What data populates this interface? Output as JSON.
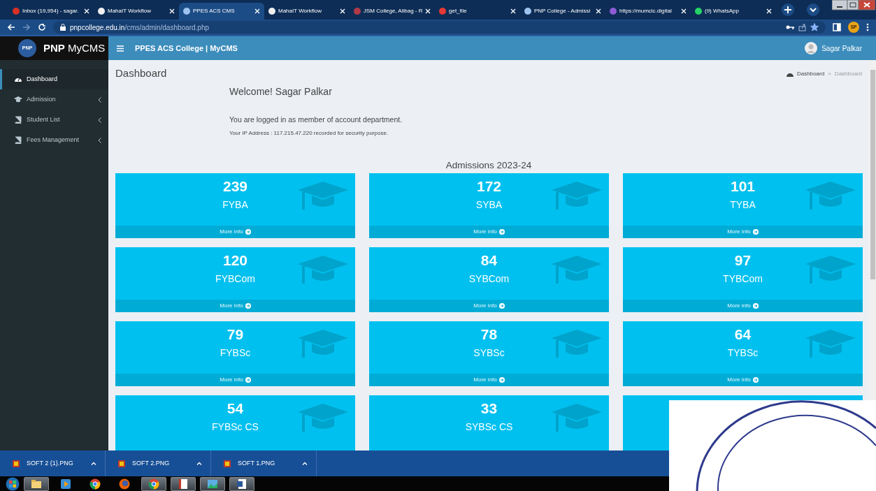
{
  "browser": {
    "tabs": [
      {
        "title": "Inbox (19,954) - sagar.",
        "selected": false,
        "color": "#d93025"
      },
      {
        "title": "MahaIT Workflow",
        "selected": false,
        "color": "#f0f0f0"
      },
      {
        "title": "PPES ACS CMS",
        "selected": true,
        "color": "#9ec3ef"
      },
      {
        "title": "MahaIT Workflow",
        "selected": false,
        "color": "#f0f0f0"
      },
      {
        "title": "JSM College, Alibag - R",
        "selected": false,
        "color": "#b23a48"
      },
      {
        "title": "get_file",
        "selected": false,
        "color": "#e53935"
      },
      {
        "title": "PNP College - Admissi",
        "selected": false,
        "color": "#9ec3ef"
      },
      {
        "title": "https://mumclc.digital",
        "selected": false,
        "color": "#8e5bd6"
      },
      {
        "title": "(9) WhatsApp",
        "selected": false,
        "color": "#25d366"
      }
    ],
    "url_host": "pnpcollege.edu.in",
    "url_path": "/cms/admin/dashboard.php",
    "forward_disabled": true,
    "bookmarked": true,
    "profile_initials": "SP"
  },
  "sidebar": {
    "logo_text": "PNP",
    "brand": "**PNP** MyCMS",
    "items": [
      {
        "label": "Dashboard",
        "kind": "gauge",
        "selected": true,
        "expandable": false
      },
      {
        "label": "Admission",
        "kind": "cap",
        "selected": false,
        "expandable": true
      },
      {
        "label": "Student List",
        "kind": "book",
        "selected": false,
        "expandable": true
      },
      {
        "label": "Fees Management",
        "kind": "book",
        "selected": false,
        "expandable": true
      }
    ]
  },
  "header": {
    "title": "PPES ACS College | MyCMS",
    "user": "Sagar Palkar"
  },
  "page": {
    "title": "Dashboard",
    "breadcrumb": [
      "Dashboard",
      ">",
      "Dashboard"
    ],
    "welcome": "Welcome! Sagar Palkar",
    "role_text": "You are logged in as member of account department.",
    "ip_text": "Your IP Address : 117.215.47.220 recorded for security purpose.",
    "section_title": "Admissions 2023-24",
    "boxes": [
      {
        "count": "239",
        "label": "FYBA",
        "footer": "More info"
      },
      {
        "count": "172",
        "label": "SYBA",
        "footer": "More info"
      },
      {
        "count": "101",
        "label": "TYBA",
        "footer": "More info"
      },
      {
        "count": "120",
        "label": "FYBCom",
        "footer": "More info"
      },
      {
        "count": "84",
        "label": "SYBCom",
        "footer": "More info"
      },
      {
        "count": "97",
        "label": "TYBCom",
        "footer": "More info"
      },
      {
        "count": "79",
        "label": "FYBSc",
        "footer": "More info"
      },
      {
        "count": "78",
        "label": "SYBSc",
        "footer": "More info"
      },
      {
        "count": "64",
        "label": "TYBSc",
        "footer": "More info"
      },
      {
        "count": "54",
        "label": "FYBSc CS"
      },
      {
        "count": "33",
        "label": "SYBSc CS"
      }
    ]
  },
  "downloads": [
    {
      "name": "SOFT 2 (1).PNG"
    },
    {
      "name": "SOFT 2.PNG"
    },
    {
      "name": "SOFT 1.PNG"
    }
  ],
  "taskbar": {
    "apps": [
      {
        "kind": "folder",
        "open": true
      },
      {
        "kind": "player",
        "open": false
      },
      {
        "kind": "chrome",
        "open": false
      },
      {
        "kind": "firefox",
        "open": false
      },
      {
        "kind": "chrome",
        "open": true
      },
      {
        "kind": "book",
        "open": true
      },
      {
        "kind": "photo",
        "open": true
      },
      {
        "kind": "word",
        "open": true
      }
    ]
  }
}
